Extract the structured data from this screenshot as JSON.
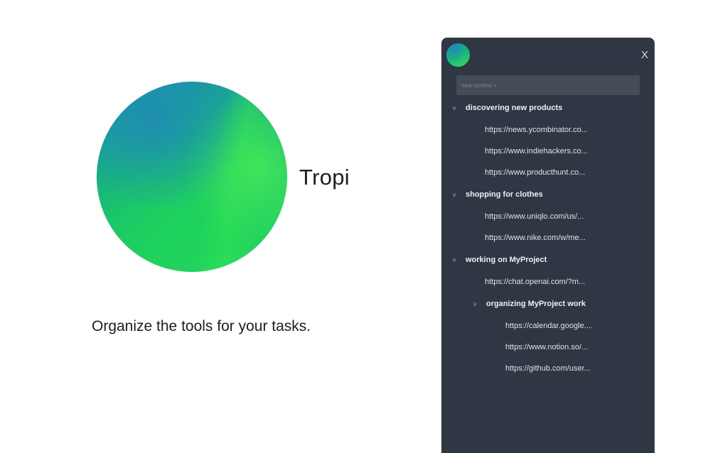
{
  "hero": {
    "brand": "Tropi",
    "tagline": "Organize the tools for your tasks."
  },
  "panel": {
    "close_label": "X",
    "search_placeholder": "new context +",
    "chevron": "v",
    "groups": [
      {
        "label": "discovering new products",
        "links": [
          "https://news.ycombinator.co...",
          "https://www.indiehackers.co...",
          "https://www.producthunt.co..."
        ]
      },
      {
        "label": "shopping for clothes",
        "links": [
          "https://www.uniqlo.com/us/...",
          "https://www.nike.com/w/me..."
        ]
      },
      {
        "label": "working on MyProject",
        "links": [
          "https://chat.openai.com/?m..."
        ],
        "subgroup": {
          "label": "organizing MyProject work",
          "links": [
            "https://calendar.google....",
            "https://www.notion.so/...",
            "https://github.com/user..."
          ]
        }
      }
    ]
  },
  "colors": {
    "panel_bg": "#2f3744",
    "input_bg": "#444c58",
    "accent_green": "#2fd866",
    "accent_blue": "#1c8bb5"
  }
}
